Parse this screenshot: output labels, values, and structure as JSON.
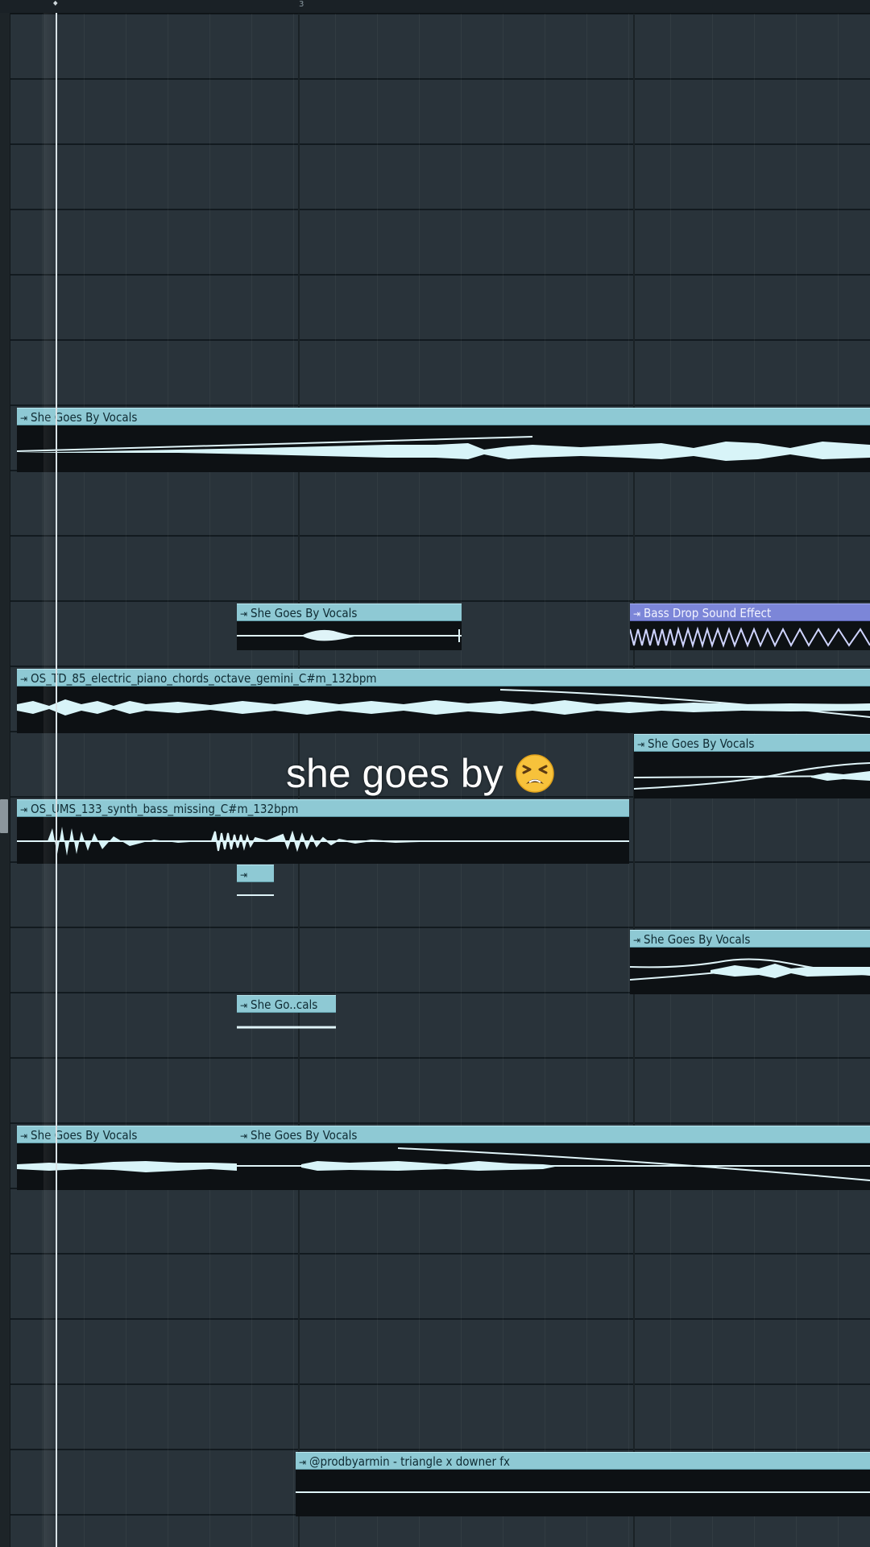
{
  "ruler": {
    "bar_number": "3"
  },
  "caption": {
    "text": "she goes by",
    "emoji_name": "tired-face-emoji"
  },
  "clips": [
    {
      "id": "c1",
      "label": "She Goes By Vocals",
      "color": "#8ec9d4"
    },
    {
      "id": "c2",
      "label": "She Goes By Vocals",
      "color": "#8ec9d4"
    },
    {
      "id": "c3",
      "label": "Bass Drop Sound Effect",
      "color": "#7c86d8"
    },
    {
      "id": "c4",
      "label": "OS_TD_85_electric_piano_chords_octave_gemini_C#m_132bpm",
      "color": "#8ec9d4"
    },
    {
      "id": "c5",
      "label": "She Goes By Vocals",
      "color": "#8ec9d4"
    },
    {
      "id": "c6",
      "label": "OS_UMS_133_synth_bass_missing_C#m_132bpm",
      "color": "#8ec9d4"
    },
    {
      "id": "c7",
      "label": "",
      "color": "#8ec9d4"
    },
    {
      "id": "c8",
      "label": "She Goes By Vocals",
      "color": "#8ec9d4"
    },
    {
      "id": "c9",
      "label": "She Go..cals",
      "color": "#8ec9d4"
    },
    {
      "id": "c10",
      "label": "She Goes By Vocals",
      "color": "#8ec9d4"
    },
    {
      "id": "c11",
      "label": "She Goes By Vocals",
      "color": "#8ec9d4"
    },
    {
      "id": "c12",
      "label": "@prodbyarmin - triangle x downer fx",
      "color": "#8ec9d4"
    }
  ]
}
